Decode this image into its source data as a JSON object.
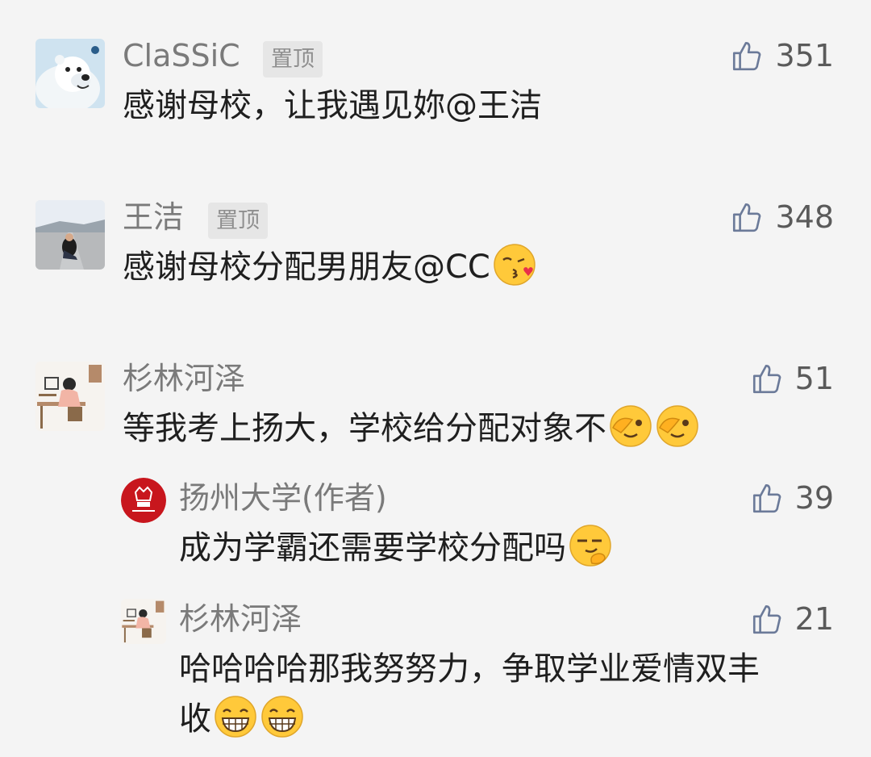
{
  "comments": [
    {
      "name": "ClaSSiC",
      "pin_label": "置顶",
      "text": "感谢母校，让我遇见妳@王洁",
      "likes": "351",
      "avatar": "polar-bear-avatar"
    },
    {
      "name": "王洁",
      "pin_label": "置顶",
      "text": "感谢母校分配男朋友@CC",
      "likes": "348",
      "avatar": "girl-on-road-avatar",
      "emoji": "kissing-emoji"
    },
    {
      "name": "杉林河泽",
      "text": "等我考上扬大，学校给分配对象不",
      "likes": "51",
      "avatar": "girl-at-desk-avatar",
      "emoji": [
        "face-palm-peek-emoji",
        "face-palm-peek-emoji"
      ]
    }
  ],
  "replies": [
    {
      "name": "扬州大学(作者)",
      "text": "成为学霸还需要学校分配吗",
      "likes": "39",
      "avatar": "university-logo-avatar",
      "emoji": "smirk-hand-chin-emoji"
    },
    {
      "name": "杉林河泽",
      "text_line1": "哈哈哈哈那我努努力，争取学业爱情双丰",
      "text_line2": "收",
      "likes": "21",
      "avatar": "girl-at-desk-avatar",
      "emoji": [
        "grinning-emoji",
        "grinning-emoji"
      ]
    }
  ],
  "colors": {
    "background": "#f4f4f4",
    "name_text": "#7a7a7a",
    "body_text": "#1f1f1f",
    "like_icon": "#6b7a99",
    "university_red": "#c8161d"
  }
}
